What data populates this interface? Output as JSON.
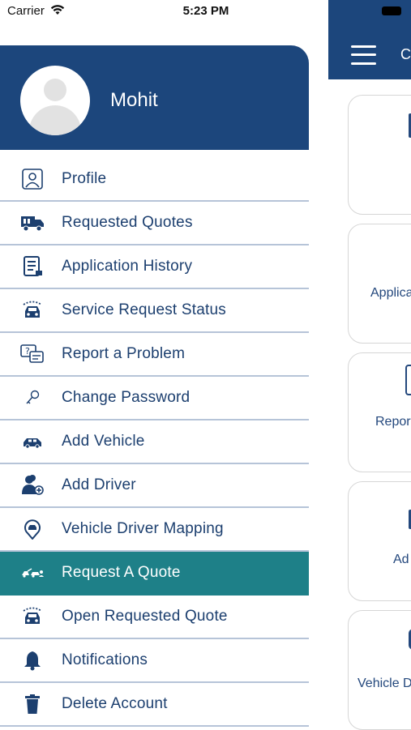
{
  "status_bar": {
    "carrier": "Carrier",
    "time": "5:23 PM"
  },
  "colors": {
    "primary": "#1c467c",
    "accent_active": "#1e8088",
    "text": "#1c3f6f",
    "divider": "#b6c4d8"
  },
  "drawer": {
    "user_name": "Mohit",
    "items": [
      {
        "label": "Profile",
        "icon": "profile-icon",
        "active": false
      },
      {
        "label": "Requested Quotes",
        "icon": "truck-icon",
        "active": false
      },
      {
        "label": "Application History",
        "icon": "document-icon",
        "active": false
      },
      {
        "label": "Service Request Status",
        "icon": "car-front-icon",
        "active": false
      },
      {
        "label": "Report a Problem",
        "icon": "report-problem-icon",
        "active": false
      },
      {
        "label": "Change Password",
        "icon": "key-icon",
        "active": false
      },
      {
        "label": "Add Vehicle",
        "icon": "car-icon",
        "active": false
      },
      {
        "label": "Add Driver",
        "icon": "add-driver-icon",
        "active": false
      },
      {
        "label": "Vehicle Driver Mapping",
        "icon": "map-pin-icon",
        "active": false
      },
      {
        "label": "Request A Quote",
        "icon": "tow-truck-icon",
        "active": true
      },
      {
        "label": "Open Requested Quote",
        "icon": "car-front-icon",
        "active": false
      },
      {
        "label": "Notifications",
        "icon": "bell-icon",
        "active": false
      },
      {
        "label": "Delete Account",
        "icon": "trash-icon",
        "active": false
      }
    ]
  },
  "background_screen": {
    "title_fragment": "C",
    "cards": [
      "",
      "Applica",
      "Repor",
      "Ad",
      "Vehicle D"
    ]
  }
}
